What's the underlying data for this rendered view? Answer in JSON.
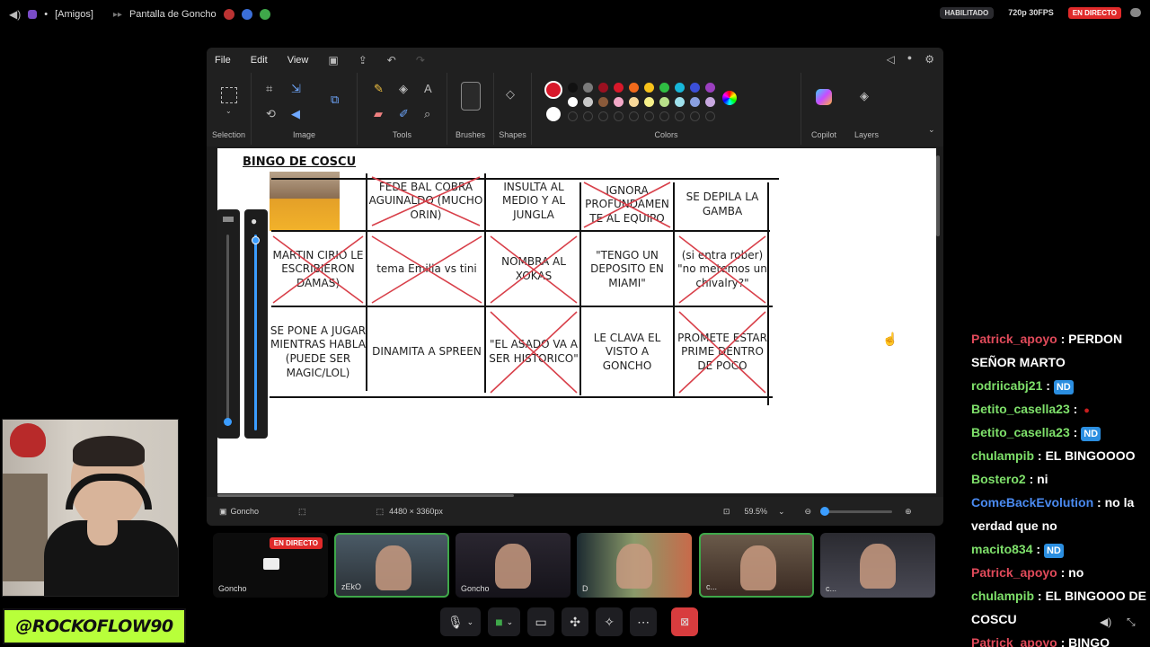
{
  "topbar": {
    "group": "[Amigos]",
    "separator": "•",
    "screen_title": "Pantalla de Goncho",
    "enabled_chip": "HABILITADO",
    "quality": "720p 30FPS",
    "live_badge": "EN DIRECTO"
  },
  "paint": {
    "menu": [
      "File",
      "Edit",
      "View"
    ],
    "groups": {
      "selection": "Selection",
      "image": "Image",
      "tools": "Tools",
      "brushes": "Brushes",
      "shapes": "Shapes",
      "colors": "Colors",
      "copilot": "Copilot",
      "layers": "Layers"
    },
    "colors_row1": [
      "#111111",
      "#7a7a7a",
      "#9b1020",
      "#d8182a",
      "#f26a1b",
      "#f7c21a",
      "#2fbe43",
      "#17b7d9",
      "#3b4fd8",
      "#9b3fbf"
    ],
    "colors_row2": [
      "#ffffff",
      "#c8c8c8",
      "#8a5a3a",
      "#f3a9c8",
      "#f7d89a",
      "#f7f08a",
      "#b8e08a",
      "#9ee0ec",
      "#8aa0e0",
      "#c8a8e0"
    ],
    "active_color": "#d8182a",
    "secondary_color": "#ffffff",
    "status": {
      "user": "Goncho",
      "dimensions": "4480 × 3360px",
      "zoom": "59.5%"
    }
  },
  "bingo": {
    "title": "BINGO DE COSCU",
    "cells": [
      {
        "text": "FEDE BAL COBRA AGUINALDO (MUCHO ORIN)",
        "crossed": true
      },
      {
        "text": "INSULTA AL MEDIO Y AL JUNGLA",
        "crossed": false
      },
      {
        "text": "IGNORA PROFUNDAMEN TE AL EQUIPO",
        "crossed": true
      },
      {
        "text": "SE DEPILA LA GAMBA",
        "crossed": false
      },
      {
        "text": "MARTIN CIRIO LE ESCRIBIERON DAMAS)",
        "crossed": true
      },
      {
        "text": "tema Emilia vs tini",
        "crossed": true
      },
      {
        "text": "NOMBRA AL XOKAS",
        "crossed": true
      },
      {
        "text": "\"TENGO UN DEPOSITO EN MIAMI\"",
        "crossed": false
      },
      {
        "text": "(si entra rober) \"no metemos un chivalry?\"",
        "crossed": true
      },
      {
        "text": "SE PONE A JUGAR MIENTRAS HABLA (PUEDE SER MAGIC/LOL)",
        "crossed": false
      },
      {
        "text": "DINAMITA A SPREEN",
        "crossed": false
      },
      {
        "text": "\"EL ASADO VA A SER HISTORICO\"",
        "crossed": true
      },
      {
        "text": "LE CLAVA EL VISTO A GONCHO",
        "crossed": false
      },
      {
        "text": "PROMETE ESTAR PRIME DENTRO DE POCO",
        "crossed": true
      }
    ]
  },
  "participants": [
    {
      "name": "Goncho",
      "live": "EN DIRECTO",
      "screen": true
    },
    {
      "name": "zEkO"
    },
    {
      "name": "Goncho"
    },
    {
      "name": "D"
    },
    {
      "name": "c..."
    },
    {
      "name": "c..."
    }
  ],
  "streamer_handle": "@ROCKOFLOW90",
  "chat": [
    {
      "nick": "Patrick_apoyo",
      "color": "#e04a5a",
      "text": ": PERDON SEÑOR MARTO"
    },
    {
      "nick": "rodriicabj21",
      "color": "#7ee06a",
      "text": ":",
      "badge": "ND"
    },
    {
      "nick": "Betito_casella23",
      "color": "#7ee06a",
      "text": ":",
      "badge": "●"
    },
    {
      "nick": "Betito_casella23",
      "color": "#7ee06a",
      "text": ":",
      "badge": "ND"
    },
    {
      "nick": "chulampib",
      "color": "#7ee06a",
      "text": ": EL BINGOOOO"
    },
    {
      "nick": "Bostero2",
      "color": "#7ee06a",
      "text": ": ni"
    },
    {
      "nick": "ComeBackEvolution",
      "color": "#4a8af0",
      "text": ": no la verdad que no"
    },
    {
      "nick": "macito834",
      "color": "#7ee06a",
      "text": ":",
      "badge": "ND"
    },
    {
      "nick": "Patrick_apoyo",
      "color": "#e04a5a",
      "text": ": no"
    },
    {
      "nick": "chulampib",
      "color": "#7ee06a",
      "text": ": EL BINGOOO DE COSCU"
    },
    {
      "nick": "Patrick_apoyo",
      "color": "#e04a5a",
      "text": ": BINGO"
    }
  ]
}
